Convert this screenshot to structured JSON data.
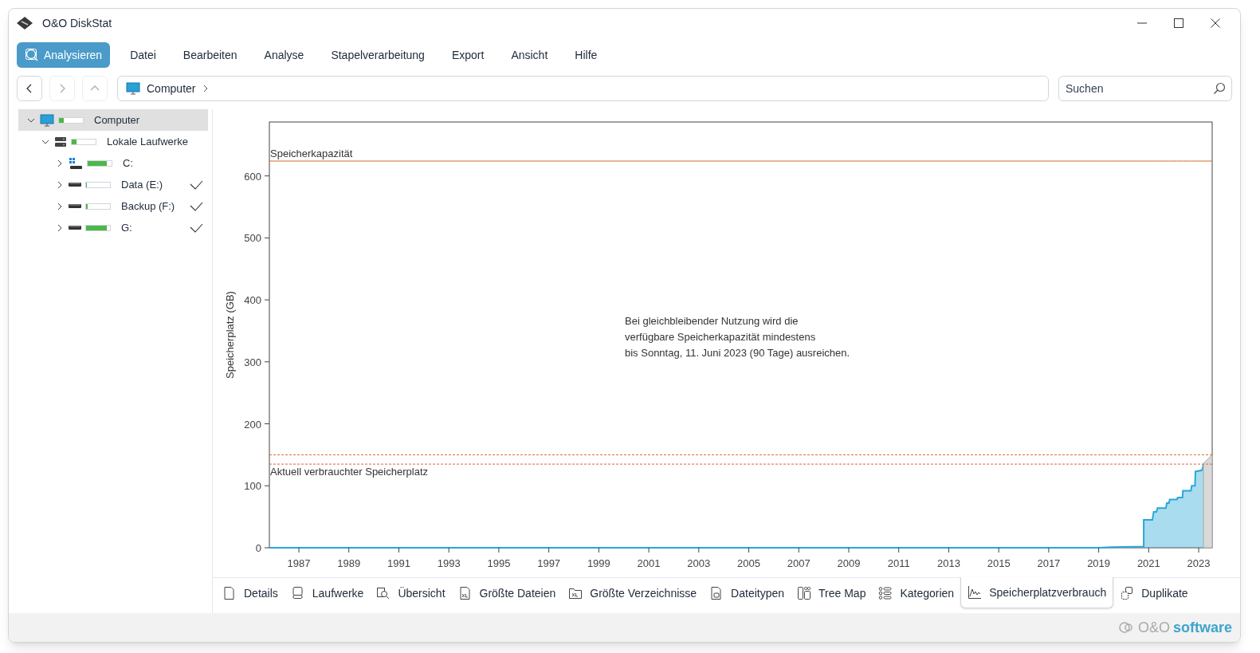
{
  "window": {
    "title": "O&O DiskStat"
  },
  "menu": {
    "primary": "Analysieren",
    "items": [
      "Datei",
      "Bearbeiten",
      "Analyse",
      "Stapelverarbeitung",
      "Export",
      "Ansicht",
      "Hilfe"
    ]
  },
  "nav": {
    "buttons": [
      {
        "kind": "back",
        "disabled": false
      },
      {
        "kind": "forward",
        "disabled": true
      },
      {
        "kind": "up",
        "disabled": true
      }
    ],
    "breadcrumb": "Computer",
    "search": {
      "placeholder": "Suchen"
    }
  },
  "tree": [
    {
      "label": "Computer",
      "kind": "computer",
      "level": 0.2,
      "selected": true,
      "expanded": true,
      "checked": false,
      "children": [
        {
          "label": "Lokale Laufwerke",
          "kind": "server",
          "level": 0.2,
          "selected": false,
          "expanded": true,
          "checked": false,
          "children": [
            {
              "label": "C:",
              "kind": "windows-drive",
              "level": 0.8,
              "selected": false,
              "expanded": false,
              "checked": false
            },
            {
              "label": "Data (E:)",
              "kind": "drive",
              "level": 0.04,
              "selected": false,
              "expanded": false,
              "checked": true
            },
            {
              "label": "Backup (F:)",
              "kind": "drive",
              "level": 0.06,
              "selected": false,
              "expanded": false,
              "checked": true
            },
            {
              "label": "G:",
              "kind": "drive",
              "level": 0.88,
              "selected": false,
              "expanded": false,
              "checked": true
            }
          ]
        }
      ]
    }
  ],
  "chart": {
    "chart_data": {
      "type": "area",
      "ylabel": "Speicherplatz (GB)",
      "xlim": [
        1985.82,
        2023.54
      ],
      "ylim": [
        0,
        687
      ],
      "x": [
        1985.82,
        2019,
        2019.5,
        2020.8,
        2020.8,
        2021.15,
        2021.2,
        2021.31,
        2021.35,
        2021.69,
        2021.72,
        2021.81,
        2021.84,
        2022.13,
        2022.16,
        2022.35,
        2022.37,
        2022.69,
        2022.72,
        2022.85,
        2022.87,
        2023.13,
        2023.16,
        2023.19,
        2023.54
      ],
      "series": [
        {
          "color": "#2aa7d6",
          "values": [
            0,
            0,
            1,
            2,
            45,
            45,
            58,
            58,
            64,
            64,
            72,
            72,
            78,
            78,
            81,
            81,
            92,
            92,
            100,
            100,
            123,
            125,
            129,
            136,
            null
          ]
        },
        {
          "color": "#d9d9d9",
          "values": [
            null,
            null,
            null,
            null,
            null,
            null,
            null,
            null,
            null,
            null,
            null,
            null,
            null,
            null,
            null,
            null,
            null,
            null,
            null,
            null,
            null,
            null,
            null,
            136,
            150
          ]
        },
        {
          "name": "Speicherkapazität",
          "type": "line",
          "color": "#d9692a",
          "values": [
            624,
            624,
            624,
            624,
            624,
            624,
            624,
            624,
            624,
            624,
            624,
            624,
            624,
            624,
            624,
            624,
            624,
            624,
            624,
            624,
            624,
            624,
            624,
            624,
            624
          ]
        },
        {
          "type": "line",
          "line_style": "dashed",
          "color": "#d9692a",
          "values": [
            150,
            150,
            150,
            150,
            150,
            150,
            150,
            150,
            150,
            150,
            150,
            150,
            150,
            150,
            150,
            150,
            150,
            150,
            150,
            150,
            150,
            150,
            150,
            150,
            150
          ]
        },
        {
          "name": "Aktuell verbrauchter Speicherplatz",
          "type": "line",
          "line_style": "dashed",
          "color": "#d9692a",
          "values": [
            135,
            135,
            135,
            135,
            135,
            135,
            135,
            135,
            135,
            135,
            135,
            135,
            135,
            135,
            135,
            135,
            135,
            135,
            135,
            135,
            135,
            135,
            135,
            135,
            135
          ]
        }
      ],
      "xticks": [
        1987,
        1989,
        1991,
        1993,
        1995,
        1997,
        1999,
        2001,
        2003,
        2005,
        2007,
        2009,
        2011,
        2013,
        2015,
        2017,
        2019,
        2021,
        2023
      ],
      "yticks": [
        0,
        100,
        200,
        300,
        400,
        500,
        600
      ]
    },
    "message": [
      "Bei gleichbleibender Nutzung wird die",
      "verfügbare Speicherkapazität mindestens",
      "bis Sonntag, 11. Juni 2023 (90 Tage) ausreichen."
    ]
  },
  "tabs": [
    {
      "label": "Details",
      "selected": false
    },
    {
      "label": "Laufwerke",
      "selected": false
    },
    {
      "label": "Übersicht",
      "selected": false
    },
    {
      "label": "Größte Dateien",
      "selected": false
    },
    {
      "label": "Größte Verzeichnisse",
      "selected": false
    },
    {
      "label": "Dateitypen",
      "selected": false
    },
    {
      "label": "Tree Map",
      "selected": false
    },
    {
      "label": "Kategorien",
      "selected": false
    },
    {
      "label": "Speicherplatzverbrauch",
      "selected": true
    },
    {
      "label": "Duplikate",
      "selected": false
    }
  ],
  "footer": {
    "brand": "O&O",
    "product": "software"
  }
}
